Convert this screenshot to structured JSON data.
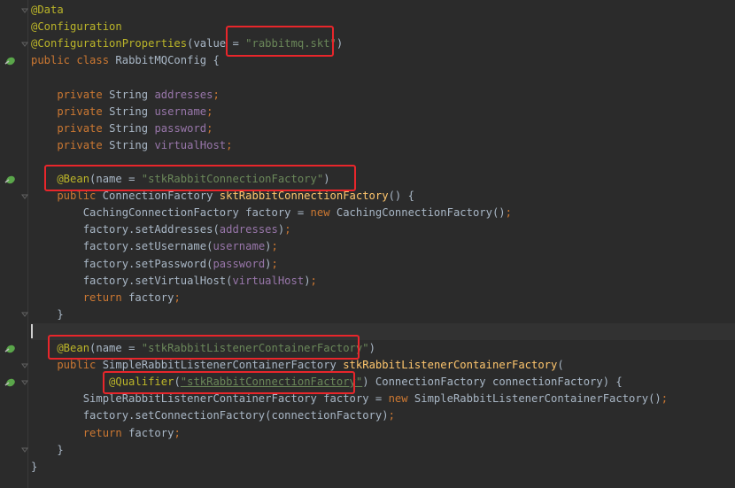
{
  "lines": [
    {
      "tokens": [
        {
          "t": "@Data",
          "c": "ann"
        }
      ]
    },
    {
      "tokens": [
        {
          "t": "@Configuration",
          "c": "ann"
        }
      ]
    },
    {
      "tokens": [
        {
          "t": "@ConfigurationProperties",
          "c": "ann"
        },
        {
          "t": "(value = ",
          "c": "plain"
        },
        {
          "t": "\"rabbitmq.skt\"",
          "c": "str"
        },
        {
          "t": ")",
          "c": "plain"
        }
      ]
    },
    {
      "tokens": [
        {
          "t": "public class ",
          "c": "kw"
        },
        {
          "t": "RabbitMQConfig {",
          "c": "plain"
        }
      ]
    },
    {
      "tokens": []
    },
    {
      "tokens": [
        {
          "t": "    private ",
          "c": "kw"
        },
        {
          "t": "String ",
          "c": "plain"
        },
        {
          "t": "addresses",
          "c": "fld"
        },
        {
          "t": ";",
          "c": "punct"
        }
      ]
    },
    {
      "tokens": [
        {
          "t": "    private ",
          "c": "kw"
        },
        {
          "t": "String ",
          "c": "plain"
        },
        {
          "t": "username",
          "c": "fld"
        },
        {
          "t": ";",
          "c": "punct"
        }
      ]
    },
    {
      "tokens": [
        {
          "t": "    private ",
          "c": "kw"
        },
        {
          "t": "String ",
          "c": "plain"
        },
        {
          "t": "password",
          "c": "fld"
        },
        {
          "t": ";",
          "c": "punct"
        }
      ]
    },
    {
      "tokens": [
        {
          "t": "    private ",
          "c": "kw"
        },
        {
          "t": "String ",
          "c": "plain"
        },
        {
          "t": "virtualHost",
          "c": "fld"
        },
        {
          "t": ";",
          "c": "punct"
        }
      ]
    },
    {
      "tokens": []
    },
    {
      "tokens": [
        {
          "t": "    @Bean",
          "c": "ann"
        },
        {
          "t": "(name = ",
          "c": "plain"
        },
        {
          "t": "\"stkRabbitConnectionFactory\"",
          "c": "str"
        },
        {
          "t": ")",
          "c": "plain"
        }
      ]
    },
    {
      "tokens": [
        {
          "t": "    public ",
          "c": "kw"
        },
        {
          "t": "ConnectionFactory ",
          "c": "plain"
        },
        {
          "t": "sktRabbitConnectionFactory",
          "c": "fn"
        },
        {
          "t": "() {",
          "c": "plain"
        }
      ]
    },
    {
      "tokens": [
        {
          "t": "        CachingConnectionFactory factory = ",
          "c": "plain"
        },
        {
          "t": "new ",
          "c": "kw"
        },
        {
          "t": "CachingConnectionFactory()",
          "c": "plain"
        },
        {
          "t": ";",
          "c": "punct"
        }
      ]
    },
    {
      "tokens": [
        {
          "t": "        factory.setAddresses(",
          "c": "plain"
        },
        {
          "t": "addresses",
          "c": "fld"
        },
        {
          "t": ")",
          "c": "plain"
        },
        {
          "t": ";",
          "c": "punct"
        }
      ]
    },
    {
      "tokens": [
        {
          "t": "        factory.setUsername(",
          "c": "plain"
        },
        {
          "t": "username",
          "c": "fld"
        },
        {
          "t": ")",
          "c": "plain"
        },
        {
          "t": ";",
          "c": "punct"
        }
      ]
    },
    {
      "tokens": [
        {
          "t": "        factory.setPassword(",
          "c": "plain"
        },
        {
          "t": "password",
          "c": "fld"
        },
        {
          "t": ")",
          "c": "plain"
        },
        {
          "t": ";",
          "c": "punct"
        }
      ]
    },
    {
      "tokens": [
        {
          "t": "        factory.setVirtualHost(",
          "c": "plain"
        },
        {
          "t": "virtualHost",
          "c": "fld"
        },
        {
          "t": ")",
          "c": "plain"
        },
        {
          "t": ";",
          "c": "punct"
        }
      ]
    },
    {
      "tokens": [
        {
          "t": "        return ",
          "c": "kw"
        },
        {
          "t": "factory",
          "c": "plain"
        },
        {
          "t": ";",
          "c": "punct"
        }
      ]
    },
    {
      "tokens": [
        {
          "t": "    }",
          "c": "plain"
        }
      ]
    },
    {
      "tokens": [],
      "current": true
    },
    {
      "tokens": [
        {
          "t": "    @Bean",
          "c": "ann"
        },
        {
          "t": "(name = ",
          "c": "plain"
        },
        {
          "t": "\"stkRabbitListenerContainerFactory\"",
          "c": "str"
        },
        {
          "t": ")",
          "c": "plain"
        }
      ]
    },
    {
      "tokens": [
        {
          "t": "    public ",
          "c": "kw"
        },
        {
          "t": "SimpleRabbitListenerContainerFactory ",
          "c": "plain"
        },
        {
          "t": "stkRabbitListenerContainerFactory",
          "c": "fn"
        },
        {
          "t": "(",
          "c": "plain"
        }
      ]
    },
    {
      "tokens": [
        {
          "t": "            @Qualifier",
          "c": "ann"
        },
        {
          "t": "(",
          "c": "plain"
        },
        {
          "t": "\"stkRabbitConnectionFactory\"",
          "c": "str",
          "u": true
        },
        {
          "t": ") ConnectionFactory connectionFactory) {",
          "c": "plain"
        }
      ]
    },
    {
      "tokens": [
        {
          "t": "        SimpleRabbitListenerContainerFactory factory = ",
          "c": "plain"
        },
        {
          "t": "new ",
          "c": "kw"
        },
        {
          "t": "SimpleRabbitListenerContainerFactory()",
          "c": "plain"
        },
        {
          "t": ";",
          "c": "punct"
        }
      ]
    },
    {
      "tokens": [
        {
          "t": "        factory.setConnectionFactory(connectionFactory)",
          "c": "plain"
        },
        {
          "t": ";",
          "c": "punct"
        }
      ]
    },
    {
      "tokens": [
        {
          "t": "        return ",
          "c": "kw"
        },
        {
          "t": "factory",
          "c": "plain"
        },
        {
          "t": ";",
          "c": "punct"
        }
      ]
    },
    {
      "tokens": [
        {
          "t": "    }",
          "c": "plain"
        }
      ]
    },
    {
      "tokens": [
        {
          "t": "}",
          "c": "plain"
        }
      ]
    }
  ],
  "gutter_icons": [
    {
      "line": 3,
      "name": "spring-bean-class-icon"
    },
    {
      "line": 10,
      "name": "spring-bean-method-icon"
    },
    {
      "line": 20,
      "name": "spring-bean-method-icon"
    },
    {
      "line": 22,
      "name": "spring-bean-injection-icon"
    }
  ],
  "highlights": [
    {
      "name": "highlight-config-properties-value"
    },
    {
      "name": "highlight-bean-connection-factory"
    },
    {
      "name": "highlight-bean-listener-container-factory"
    },
    {
      "name": "highlight-qualifier"
    }
  ],
  "colors": {
    "background": "#2b2b2b",
    "keyword": "#cc7832",
    "annotation": "#bbb529",
    "string": "#6a8759",
    "field": "#9876aa",
    "method": "#ffc66d",
    "text": "#a9b7c6",
    "highlight_box": "#e8262b"
  }
}
